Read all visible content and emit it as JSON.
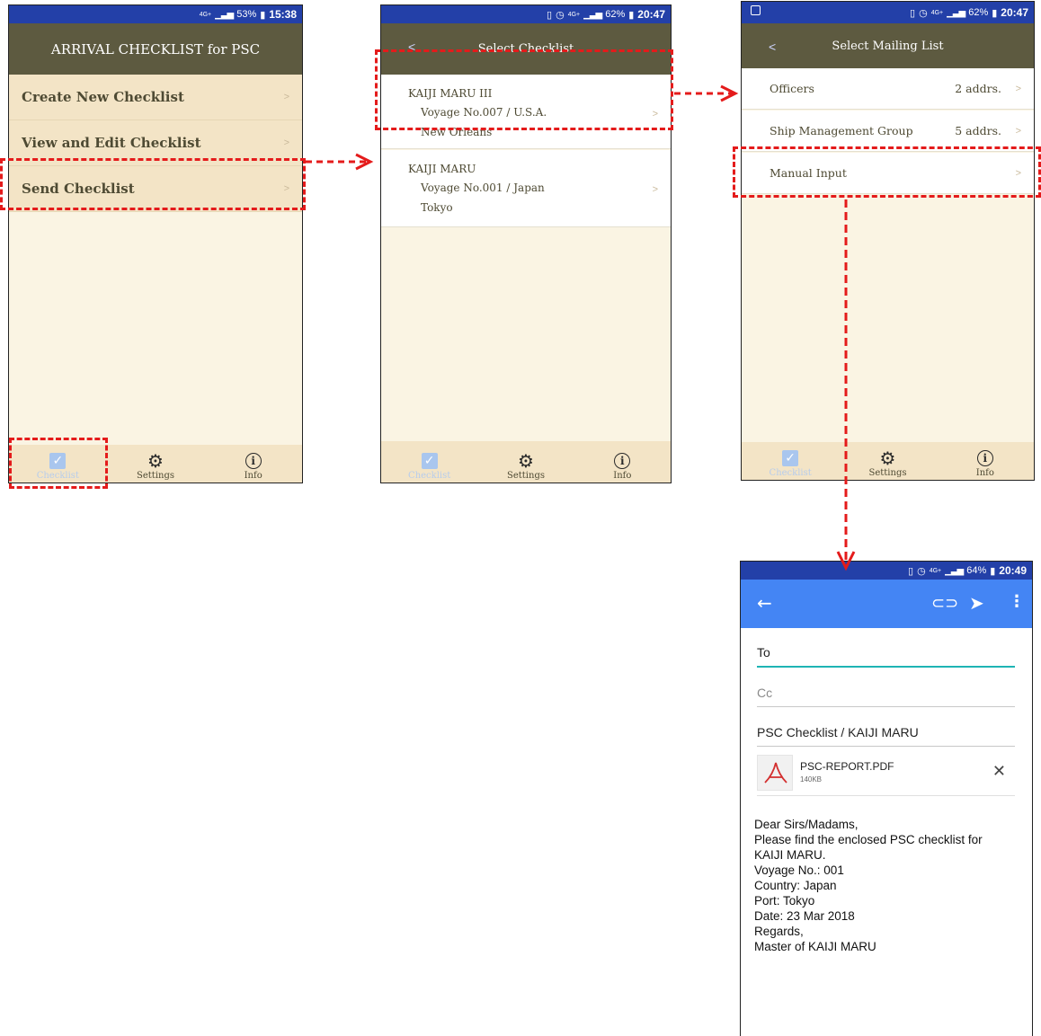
{
  "screen1": {
    "status": {
      "network": "4G+",
      "battery": "53%",
      "time": "15:38"
    },
    "title": "ARRIVAL CHECKLIST for PSC",
    "menu": [
      {
        "label": "Create New Checklist",
        "chevron": ">"
      },
      {
        "label": "View and Edit Checklist",
        "chevron": ">"
      },
      {
        "label": "Send Checklist",
        "chevron": ">"
      }
    ],
    "tabs": {
      "checklist": "Checklist",
      "settings": "Settings",
      "info": "Info"
    }
  },
  "screen2": {
    "status": {
      "network": "4G+",
      "battery": "62%",
      "time": "20:47"
    },
    "back": "<",
    "title": "Select Checklist",
    "items": [
      {
        "ship": "KAIJI MARU III",
        "voyage": "Voyage No.007 / U.S.A.",
        "port": "New Orleans",
        "chevron": ">"
      },
      {
        "ship": "KAIJI MARU",
        "voyage": "Voyage No.001 / Japan",
        "port": "Tokyo",
        "chevron": ">"
      }
    ],
    "tabs": {
      "checklist": "Checklist",
      "settings": "Settings",
      "info": "Info"
    }
  },
  "screen3": {
    "status": {
      "network": "4G+",
      "battery": "62%",
      "time": "20:47"
    },
    "back": "<",
    "title": "Select Mailing List",
    "items": [
      {
        "label": "Officers",
        "count": "2 addrs.",
        "chevron": ">"
      },
      {
        "label": "Ship Management Group",
        "count": "5 addrs.",
        "chevron": ">"
      },
      {
        "label": "Manual Input",
        "count": "",
        "chevron": ">"
      }
    ],
    "tabs": {
      "checklist": "Checklist",
      "settings": "Settings",
      "info": "Info"
    }
  },
  "screen4": {
    "status": {
      "network": "4G+",
      "battery": "64%",
      "time": "20:49"
    },
    "to_placeholder": "To",
    "cc_placeholder": "Cc",
    "subject": "PSC Checklist / KAIJI MARU",
    "attachment": {
      "name": "PSC-REPORT.PDF",
      "size": "140KB"
    },
    "body_lines": [
      "Dear Sirs/Madams,",
      "Please find the enclosed PSC checklist for",
      "KAIJI MARU.",
      "Voyage No.: 001",
      "Country: Japan",
      "Port: Tokyo",
      "Date: 23 Mar 2018",
      "Regards,",
      "Master of KAIJI MARU"
    ]
  },
  "colors": {
    "status_bar": "#2340a8",
    "app_bar": "#5d5a40",
    "menu_bg": "#f3e4c6",
    "screen_bg": "#faf4e3",
    "mail_toolbar": "#4485f4",
    "highlight_dash": "#e41b1b",
    "active_tab": "#a9c6ee"
  }
}
